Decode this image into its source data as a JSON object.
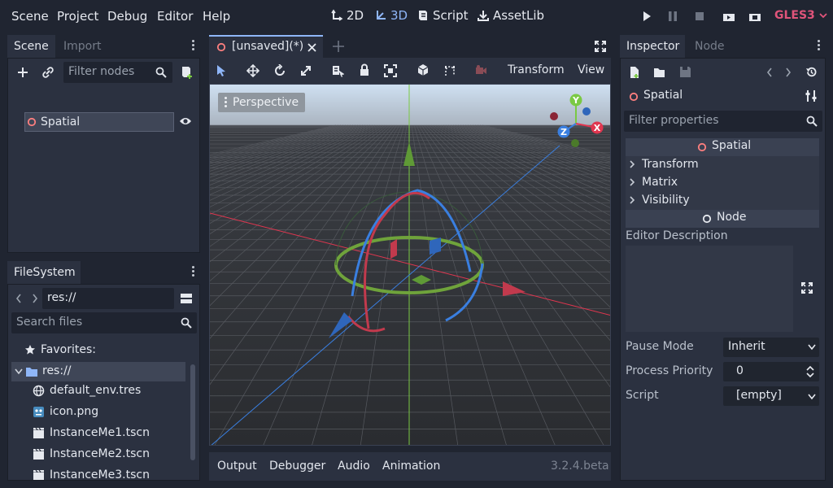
{
  "menu": [
    "Scene",
    "Project",
    "Debug",
    "Editor",
    "Help"
  ],
  "modes": {
    "m2d": "2D",
    "m3d": "3D",
    "script": "Script",
    "assetlib": "AssetLib"
  },
  "renderer": "GLES3",
  "scene_dock": {
    "tabs": [
      "Scene",
      "Import"
    ],
    "filter_placeholder": "Filter nodes",
    "root_node": "Spatial"
  },
  "filesystem_dock": {
    "title": "FileSystem",
    "path": "res://",
    "search_placeholder": "Search files",
    "favorites": "Favorites:",
    "root": "res://",
    "files": [
      {
        "name": "default_env.tres",
        "icon": "globe-icon"
      },
      {
        "name": "icon.png",
        "icon": "image-icon"
      },
      {
        "name": "InstanceMe1.tscn",
        "icon": "scene-icon"
      },
      {
        "name": "InstanceMe2.tscn",
        "icon": "scene-icon"
      },
      {
        "name": "InstanceMe3.tscn",
        "icon": "scene-icon"
      }
    ]
  },
  "editor": {
    "tab": "[unsaved](*)",
    "toolbar_transform": "Transform",
    "toolbar_view": "View",
    "viewport_label": "Perspective",
    "gizmo": {
      "y": "Y",
      "z": "Z",
      "x": "X"
    }
  },
  "bottom": {
    "tabs": [
      "Output",
      "Debugger",
      "Audio",
      "Animation"
    ],
    "version": "3.2.4.beta"
  },
  "inspector": {
    "tabs": [
      "Inspector",
      "Node"
    ],
    "node_name": "Spatial",
    "filter_placeholder": "Filter properties",
    "section1": "Spatial",
    "groups": [
      "Transform",
      "Matrix",
      "Visibility"
    ],
    "section2": "Node",
    "editor_description": "Editor Description",
    "props": [
      {
        "label": "Pause Mode",
        "value": "Inherit"
      },
      {
        "label": "Process Priority",
        "value": "0"
      },
      {
        "label": "Script",
        "value": "[empty]"
      }
    ]
  },
  "colors": {
    "accent": "#8fb6f8",
    "renderer": "#e0547a",
    "x_axis": "#e0364f",
    "y_axis": "#7ac943",
    "z_axis": "#3a7fe0",
    "node_ring": "#fc7f7f"
  }
}
